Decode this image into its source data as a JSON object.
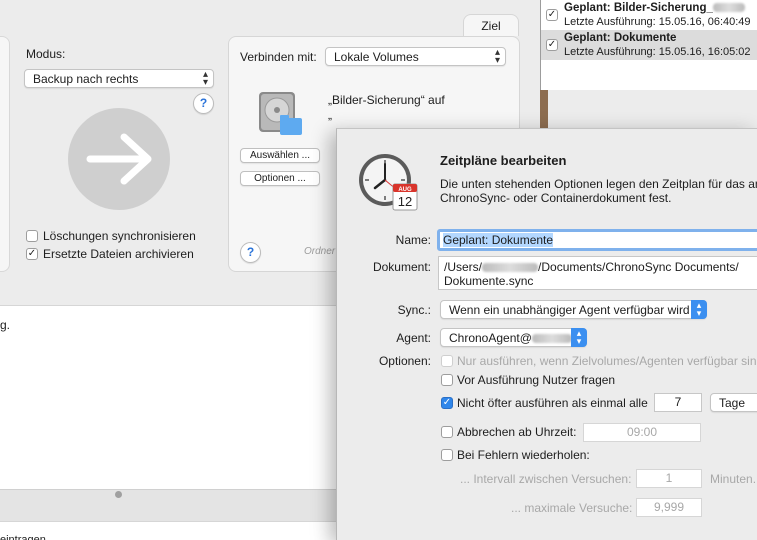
{
  "main": {
    "modus_label": "Modus:",
    "modus_value": "Backup nach rechts",
    "help": "?",
    "sync_deletions": "Löschungen synchronisieren",
    "archive_replaced": "Ersetzte Dateien archivieren",
    "ziel_tab": "Ziel",
    "connect_label": "Verbinden mit:",
    "connect_value": "Lokale Volumes",
    "target_text": "„Bilder-Sicherung“ auf",
    "target_text2": "„",
    "choose_button": "Auswählen ...",
    "options_button": "Optionen ...",
    "folder_hint": "Ordner",
    "log_text": "g.",
    "log_bottom_text": "eintragen"
  },
  "schedules": [
    {
      "title": "Geplant: Bilder-Sicherung_",
      "subtitle": "Letzte Ausführung: 15.05.16, 06:40:49",
      "checked": true,
      "selected": false
    },
    {
      "title": "Geplant: Dokumente",
      "subtitle": "Letzte Ausführung: 15.05.16, 16:05:02",
      "checked": true,
      "selected": true
    }
  ],
  "dialog": {
    "title": "Zeitpläne bearbeiten",
    "desc_line1": "Die unten stehenden Optionen legen den Zeitplan für das ang",
    "desc_line2": "ChronoSync- oder Containerdokument fest.",
    "calendar_month": "AUG",
    "calendar_day": "12",
    "name_label": "Name:",
    "name_value": "Geplant: Dokumente",
    "document_label": "Dokument:",
    "document_path_start": "/Users/",
    "document_path_end": "/Documents/ChronoSync Documents/",
    "document_line2": "Dokumente.sync",
    "sync_label": "Sync.:",
    "sync_value": "Wenn ein unabhängiger Agent verfügbar wird",
    "agent_label": "Agent:",
    "agent_value": "ChronoAgent@",
    "options_label": "Optionen:",
    "opt_only_available": "Nur ausführen, wenn Zielvolumes/Agenten verfügbar sind",
    "opt_ask_user": "Vor Ausführung Nutzer fragen",
    "opt_not_more_often": "Nicht öfter ausführen als einmal alle",
    "interval_value": "7",
    "interval_unit": "Tage",
    "opt_abort_at": "Abbrechen ab Uhrzeit:",
    "abort_time": "09:00",
    "opt_retry": "Bei Fehlern wiederholen:",
    "retry_interval_label": "... Intervall zwischen Versuchen:",
    "retry_interval_value": "1",
    "retry_interval_unit": "Minuten.",
    "max_attempts_label": "... maximale Versuche:",
    "max_attempts_value": "9,999"
  },
  "colors": {
    "accent": "#2f86ea",
    "selection": "#b3d7ff",
    "focus_ring": "#7fb1ec"
  }
}
